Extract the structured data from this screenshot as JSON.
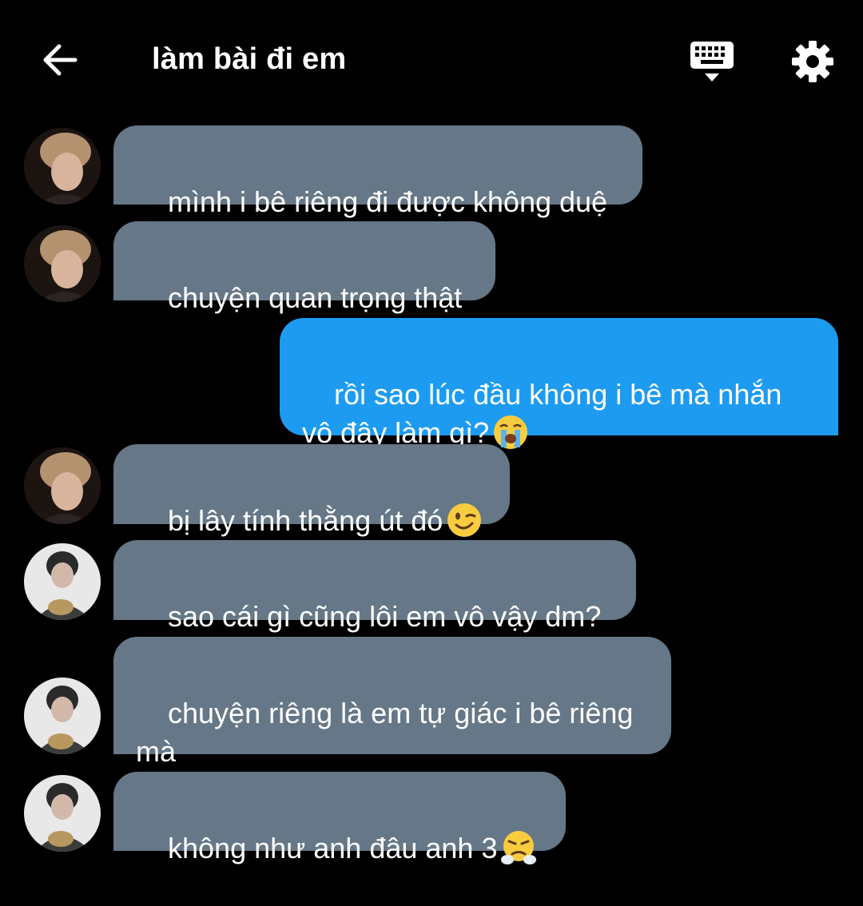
{
  "header": {
    "title": "làm bài đi em",
    "back_icon": "arrow-left-icon",
    "keyboard_icon": "keyboard-icon",
    "settings_icon": "gear-icon"
  },
  "colors": {
    "background": "#000000",
    "incoming_bubble": "#667787",
    "outgoing_bubble": "#1d9bf0",
    "text": "#ffffff"
  },
  "messages": [
    {
      "direction": "incoming",
      "sender": "contact-a",
      "text": "mình i bê riêng đi được không duệ",
      "emoji": ""
    },
    {
      "direction": "incoming",
      "sender": "contact-a",
      "text": "chuyện quan trọng thật",
      "emoji": ""
    },
    {
      "direction": "outgoing",
      "sender": "me",
      "text": "rồi sao lúc đầu không i bê mà nhắn\nvô đây làm gì?",
      "emoji": "loudly-crying-face"
    },
    {
      "direction": "incoming",
      "sender": "contact-a",
      "text": "bị lây tính thằng út đó",
      "emoji": "winking-face"
    },
    {
      "direction": "incoming",
      "sender": "contact-b",
      "text": "sao cái gì cũng lôi em vô vậy dm?",
      "emoji": ""
    },
    {
      "direction": "incoming",
      "sender": "contact-b",
      "text": "chuyện riêng là em tự giác i bê riêng\nmà",
      "emoji": ""
    },
    {
      "direction": "incoming",
      "sender": "contact-b",
      "text": "không như anh đâu anh 3",
      "emoji": "face-with-steam-from-nose"
    }
  ]
}
